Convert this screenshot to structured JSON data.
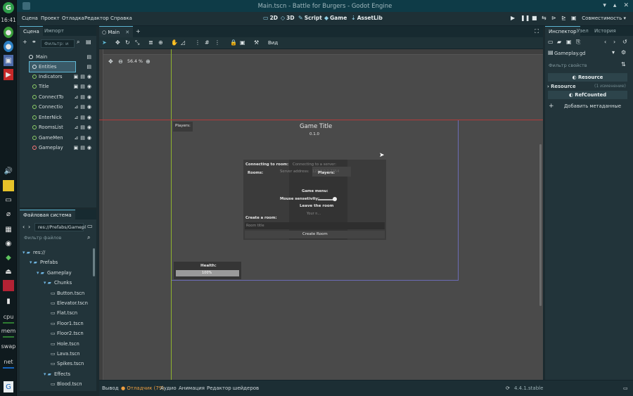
{
  "window": {
    "title": "Main.tscn - Battle for Burgers - Godot Engine"
  },
  "os_dock": {
    "clock": "16:41",
    "cpu_label": "cpu",
    "mem_label": "mem",
    "swap_label": "swap",
    "net_label": "net"
  },
  "menu": {
    "items": [
      "Сцена",
      "Проект",
      "Отладка",
      "Редактор",
      "Справка"
    ],
    "workspaces": [
      "2D",
      "3D",
      "Script",
      "Game",
      "AssetLib"
    ],
    "renderer": "Совместимость"
  },
  "scene_panel": {
    "tabs": [
      "Сцена",
      "Импорт"
    ],
    "filter_placeholder": "Фильтр: и",
    "nodes": [
      {
        "name": "Main",
        "level": 0
      },
      {
        "name": "Entities",
        "level": 1,
        "selected": true
      },
      {
        "name": "Indicators",
        "level": 1
      },
      {
        "name": "Title",
        "level": 1
      },
      {
        "name": "ConnectTo",
        "level": 1
      },
      {
        "name": "Connectio",
        "level": 1
      },
      {
        "name": "EnterNick",
        "level": 1
      },
      {
        "name": "RoomsList",
        "level": 1
      },
      {
        "name": "GameMen",
        "level": 1
      },
      {
        "name": "Gameplay",
        "level": 1
      }
    ]
  },
  "filesystem_panel": {
    "tab": "Файловая система",
    "path": "res://Prefabs/Gamepl",
    "filter_placeholder": "Фильтр файлов",
    "items": [
      {
        "name": "res://",
        "type": "folder",
        "level": 0
      },
      {
        "name": "Prefabs",
        "type": "folder",
        "level": 1
      },
      {
        "name": "Gameplay",
        "type": "folder",
        "level": 2
      },
      {
        "name": "Chunks",
        "type": "folder",
        "level": 3
      },
      {
        "name": "Button.tscn",
        "type": "file",
        "level": 4
      },
      {
        "name": "Elevator.tscn",
        "type": "file",
        "level": 4
      },
      {
        "name": "Flat.tscn",
        "type": "file",
        "level": 4
      },
      {
        "name": "Floor1.tscn",
        "type": "file",
        "level": 4
      },
      {
        "name": "Floor2.tscn",
        "type": "file",
        "level": 4
      },
      {
        "name": "Hole.tscn",
        "type": "file",
        "level": 4
      },
      {
        "name": "Lava.tscn",
        "type": "file",
        "level": 4
      },
      {
        "name": "Spikes.tscn",
        "type": "file",
        "level": 4
      },
      {
        "name": "Effects",
        "type": "folder",
        "level": 3
      },
      {
        "name": "Blood.tscn",
        "type": "file",
        "level": 4
      }
    ]
  },
  "viewport": {
    "tab": "Main",
    "toolbar_view": "Вид",
    "zoom": "56.4 %",
    "game": {
      "players_label": "Players:",
      "title": "Game Title",
      "version": "0.1.0",
      "connecting_to_room": "Connecting to room:",
      "connecting_to_server": "Connecting to a server:",
      "rooms_label": "Rooms:",
      "server_address": "Server address:",
      "server_hint": "127.0.0.1:7354",
      "players_label2": "Players:",
      "game_menu": "Game menu:",
      "mouse_sens": "Mouse sensetivity:",
      "leave_room": "Leave the room",
      "your_nick": "Your n...",
      "create_room_label": "Create a room:",
      "room_title_placeholder": "Room title",
      "create_room_btn": "Create Room",
      "health_label": "Health:",
      "health_value": "100%"
    }
  },
  "bottom_bar": {
    "items": [
      "Вывод",
      "Отладчик (79)",
      "Аудио",
      "Анимация",
      "Редактор шейдеров"
    ],
    "version": "4.4.1.stable"
  },
  "inspector": {
    "tabs": [
      "Инспектор",
      "Узел",
      "История"
    ],
    "object": "Gameplay.gd",
    "filter_placeholder": "Фильтр свойств",
    "resource_btn": "Resource",
    "resource_section": "Resource",
    "resource_changes": "(1 изменение)",
    "refcounted_btn": "RefCounted",
    "add_metadata": "Добавить метаданные"
  },
  "colors": {
    "accent": "#5fb8d5",
    "viewport_bg": "#4a4a4a",
    "node_green": "#8fd16a",
    "debugger_orange": "#f0a040"
  }
}
